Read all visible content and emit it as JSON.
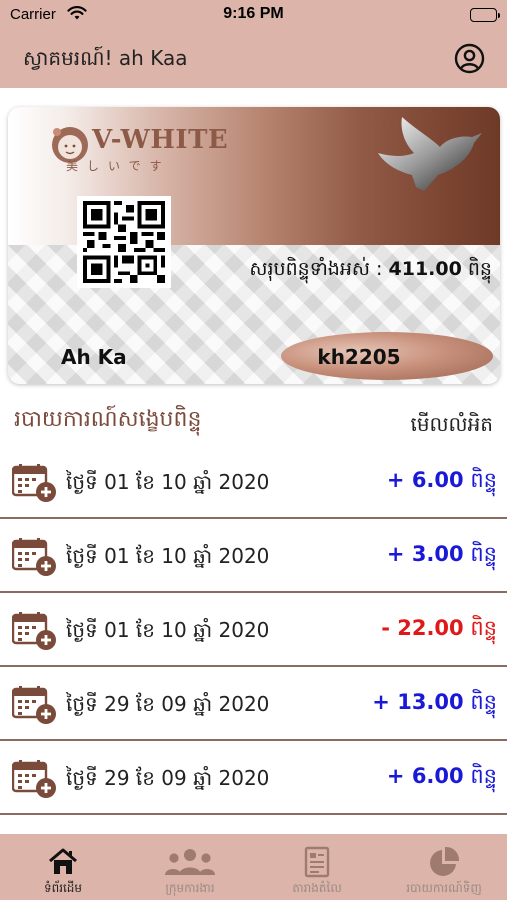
{
  "status_bar": {
    "carrier": "Carrier",
    "time": "9:16 PM"
  },
  "header": {
    "greeting": "ស្វាគមរណ៍! ah Kaa",
    "profile_icon": "user-circle-icon"
  },
  "card": {
    "brand": "V-WHITE",
    "brand_subtitle": "美しいです",
    "total_label": "សរុបពិន្ទុទាំងអស់ :",
    "total_value": "411.00",
    "total_unit": "ពិន្ទុ",
    "holder_name": "Ah Ka",
    "member_code": "kh2205"
  },
  "section": {
    "title": "របាយការណ៍សង្ខេបពិន្ទុ",
    "see_detail": "មើលលំអិត"
  },
  "transactions": [
    {
      "date": "ថ្ងៃទី 01 ខែ 10 ឆ្នាំ 2020",
      "amount": "+ 6.00",
      "unit": "ពិន្ទុ",
      "type": "pos"
    },
    {
      "date": "ថ្ងៃទី 01 ខែ 10 ឆ្នាំ 2020",
      "amount": "+ 3.00",
      "unit": "ពិន្ទុ",
      "type": "pos"
    },
    {
      "date": "ថ្ងៃទី 01 ខែ 10 ឆ្នាំ 2020",
      "amount": "- 22.00",
      "unit": "ពិន្ទុ",
      "type": "neg"
    },
    {
      "date": "ថ្ងៃទី 29 ខែ 09 ឆ្នាំ 2020",
      "amount": "+ 13.00",
      "unit": "ពិន្ទុ",
      "type": "pos"
    },
    {
      "date": "ថ្ងៃទី 29 ខែ 09 ឆ្នាំ 2020",
      "amount": "+ 6.00",
      "unit": "ពិន្ទុ",
      "type": "pos"
    }
  ],
  "tabs": [
    {
      "label": "ទំព័រដើម",
      "icon": "home-icon",
      "active": true
    },
    {
      "label": "ក្រុមការងារ",
      "icon": "group-icon",
      "active": false
    },
    {
      "label": "តារាងតំលៃ",
      "icon": "price-list-icon",
      "active": false
    },
    {
      "label": "របាយការណ៍ទិញ",
      "icon": "pie-chart-icon",
      "active": false
    }
  ],
  "colors": {
    "header_bg": "#ddb4a9",
    "accent": "#7a4a3a",
    "positive": "#1a1ad6",
    "negative": "#e01818"
  }
}
